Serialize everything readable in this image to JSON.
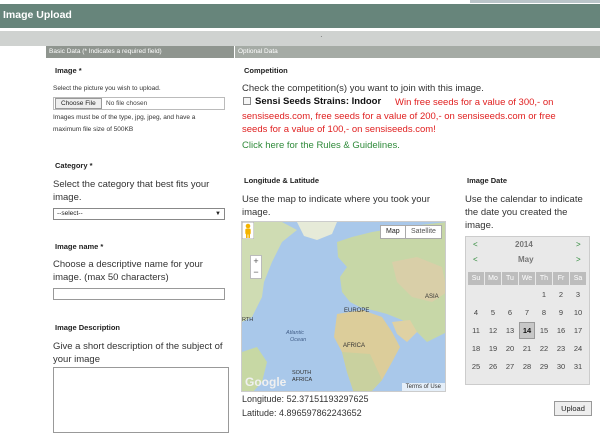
{
  "header": {
    "title": "Image Upload"
  },
  "sections": {
    "basic_label": "Basic Data (* Indicates a required field)",
    "optional_label": "Optional Data"
  },
  "image": {
    "label": "Image *",
    "help": "Select the picture you wish to upload.",
    "choose_label": "Choose File",
    "no_file": "No file chosen",
    "note1": "Images must be of the type, jpg, jpeg, and have a",
    "note2": "maximum file size of 500KB"
  },
  "category": {
    "label": "Category *",
    "help1": "Select the category that best fits your",
    "help2": "image.",
    "selected": "--select--"
  },
  "image_name": {
    "label": "Image name *",
    "help1": "Choose a descriptive name for your",
    "help2": "image. (max 50 characters)",
    "value": ""
  },
  "image_description": {
    "label": "Image Description",
    "help1": "Give a short description of the subject of",
    "help2": "your image",
    "value": ""
  },
  "competition": {
    "label": "Competition",
    "help": "Check the competition(s) you want to join with this image.",
    "strain": "Sensi Seeds Strains: Indoor",
    "promo": "Win free seeds for a value of 300,- on sensiseeds.com, free seeds for a value of 200,- on sensiseeds.com or free seeds for a value of 100,- on sensiseeds.com!",
    "checked": false,
    "rules_link": "Click here for the Rules & Guidelines."
  },
  "location": {
    "label": "Longitude & Latitude",
    "help1": "Use the map to indicate where you took your",
    "help2": "image.",
    "map_btn": "Map",
    "sat_btn": "Satellite",
    "google": "Google",
    "terms": "Terms of Use",
    "map_labels": {
      "europe": "EUROPE",
      "asia": "ASIA",
      "africa": "AFRICA",
      "north": "RTH",
      "atlantic1": "Atlantic",
      "atlantic2": "Ocean",
      "south": "SOUTH",
      "south_africa": "AFRICA"
    },
    "longitude_label": "Longitude:",
    "longitude": "52.37151193297625",
    "latitude_label": "Latitude:",
    "latitude": "4.896597862243652"
  },
  "date": {
    "label": "Image Date",
    "help1": "Use the calendar to indicate",
    "help2": "the date you created the",
    "help3": "image.",
    "year": "2014",
    "month": "May",
    "prev": "<",
    "next": ">",
    "weekdays": [
      "Su",
      "Mo",
      "Tu",
      "We",
      "Th",
      "Fr",
      "Sa"
    ],
    "weeks": [
      [
        "",
        "",
        "",
        "",
        "1",
        "2",
        "3"
      ],
      [
        "4",
        "5",
        "6",
        "7",
        "8",
        "9",
        "10"
      ],
      [
        "11",
        "12",
        "13",
        "14",
        "15",
        "16",
        "17"
      ],
      [
        "18",
        "19",
        "20",
        "21",
        "22",
        "23",
        "24"
      ],
      [
        "25",
        "26",
        "27",
        "28",
        "29",
        "30",
        "31"
      ]
    ],
    "selected": "14"
  },
  "actions": {
    "upload": "Upload"
  },
  "colors": {
    "header": "#67857b",
    "promo": "#e02020",
    "link": "#2f8a3a"
  }
}
